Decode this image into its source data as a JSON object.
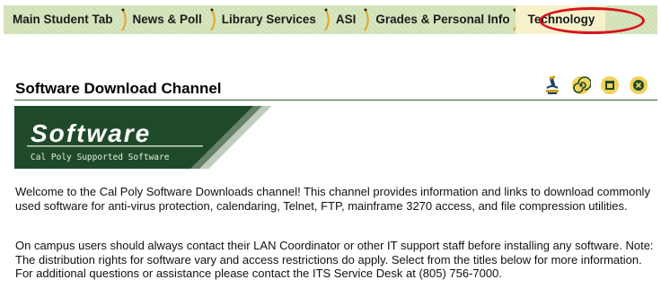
{
  "tabs": [
    {
      "label": "Main Student Tab",
      "active": false
    },
    {
      "label": "News & Poll",
      "active": false
    },
    {
      "label": "Library Services",
      "active": false
    },
    {
      "label": "ASI",
      "active": false
    },
    {
      "label": "Grades & Personal Info",
      "active": false
    },
    {
      "label": "Technology",
      "active": true
    }
  ],
  "channel": {
    "title": "Software Download Channel",
    "icons": [
      "microscope-icon",
      "spiral-icon",
      "maximize-icon",
      "close-icon"
    ]
  },
  "banner": {
    "title": "Software",
    "subtitle": "Cal Poly Supported Software"
  },
  "content": {
    "paragraph1": "Welcome to the Cal Poly Software Downloads channel! This channel provides information and links to download commonly used software for anti-virus protection, calendaring, Telnet, FTP, mainframe 3270 access, and file compression utilities.",
    "paragraph2": "On campus users should always contact their LAN Coordinator or other IT support staff before installing any software. Note: The distribution rights for software vary and access restrictions do apply. Select from the titles below for more information. For additional questions or assistance please contact the ITS Service Desk at (805) 756-7000."
  },
  "colors": {
    "tabbar_bg": "#cfe0b4",
    "active_tab_bg": "#f6f1c9",
    "highlight_ring": "#d8121c",
    "banner_bg": "#1f4a2a",
    "separator": "#e0a52a"
  }
}
